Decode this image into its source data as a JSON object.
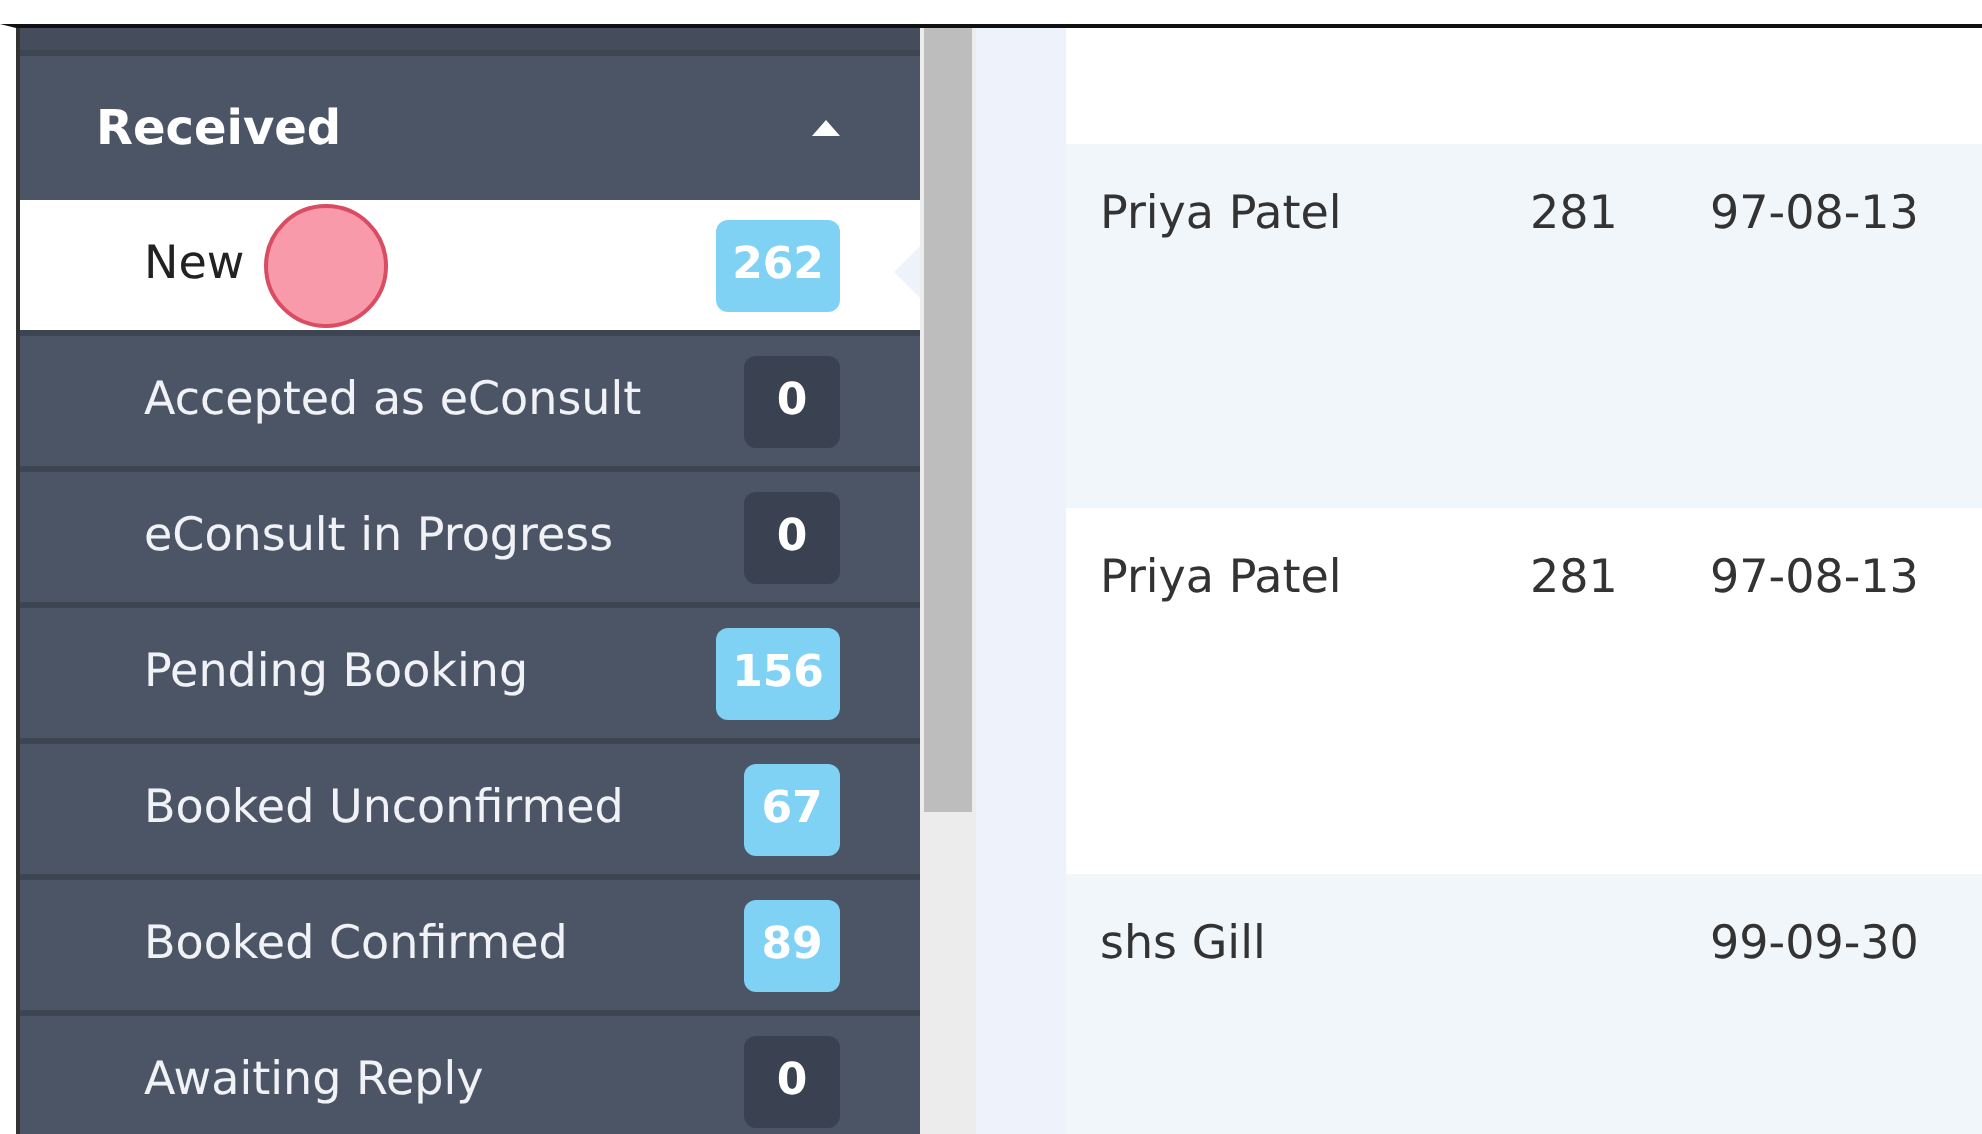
{
  "sidebar": {
    "section": {
      "title": "Received",
      "expanded": true
    },
    "items": [
      {
        "label": "New",
        "count": "262",
        "selected": true,
        "color": "#7fd2f4"
      },
      {
        "label": "Accepted as eConsult",
        "count": "0",
        "selected": false,
        "color": "#3a4150"
      },
      {
        "label": "eConsult in Progress",
        "count": "0",
        "selected": false,
        "color": "#3a4150"
      },
      {
        "label": "Pending Booking",
        "count": "156",
        "selected": false,
        "color": "#7fd2f4"
      },
      {
        "label": "Booked Unconfirmed",
        "count": "67",
        "selected": false,
        "color": "#7fd2f4"
      },
      {
        "label": "Booked Confirmed",
        "count": "89",
        "selected": false,
        "color": "#7fd2f4"
      },
      {
        "label": "Awaiting Reply",
        "count": "0",
        "selected": false,
        "color": "#3a4150"
      }
    ]
  },
  "table": {
    "rows": [
      {
        "cells": []
      },
      {
        "cells": [
          "Priya Patel",
          "281",
          "97-08-13"
        ]
      },
      {
        "cells": [
          "Priya Patel",
          "281",
          "97-08-13"
        ]
      },
      {
        "cells": [
          "shs Gill",
          "",
          "99-09-30"
        ]
      }
    ]
  }
}
